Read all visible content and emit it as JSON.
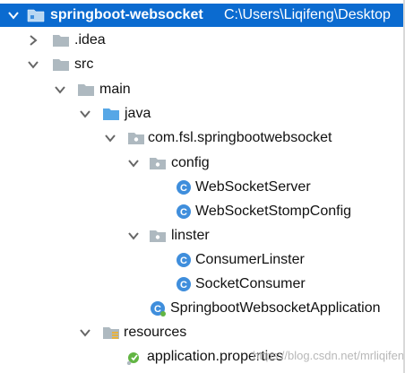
{
  "project_tree": {
    "root": {
      "name": "springboot-websocket",
      "path": "C:\\Users\\Liqifeng\\Desktop"
    },
    "idea": ".idea",
    "src": "src",
    "main": "main",
    "java": "java",
    "package": "com.fsl.springbootwebsocket",
    "config": "config",
    "websocket_server": "WebSocketServer",
    "websocket_stomp_config": "WebSocketStompConfig",
    "linster": "linster",
    "consumer_linster": "ConsumerLinster",
    "socket_consumer": "SocketConsumer",
    "application_class": "SpringbootWebsocketApplication",
    "resources": "resources",
    "application_properties": "application.properties"
  },
  "watermark": "https://blog.csdn.net/mrliqifeng",
  "colors": {
    "selection_bg": "#0b6bd0",
    "folder_gray": "#aeb9c0",
    "source_folder_blue": "#57a7e6",
    "class_blue": "#3f8edc",
    "spring_green": "#62b543"
  }
}
